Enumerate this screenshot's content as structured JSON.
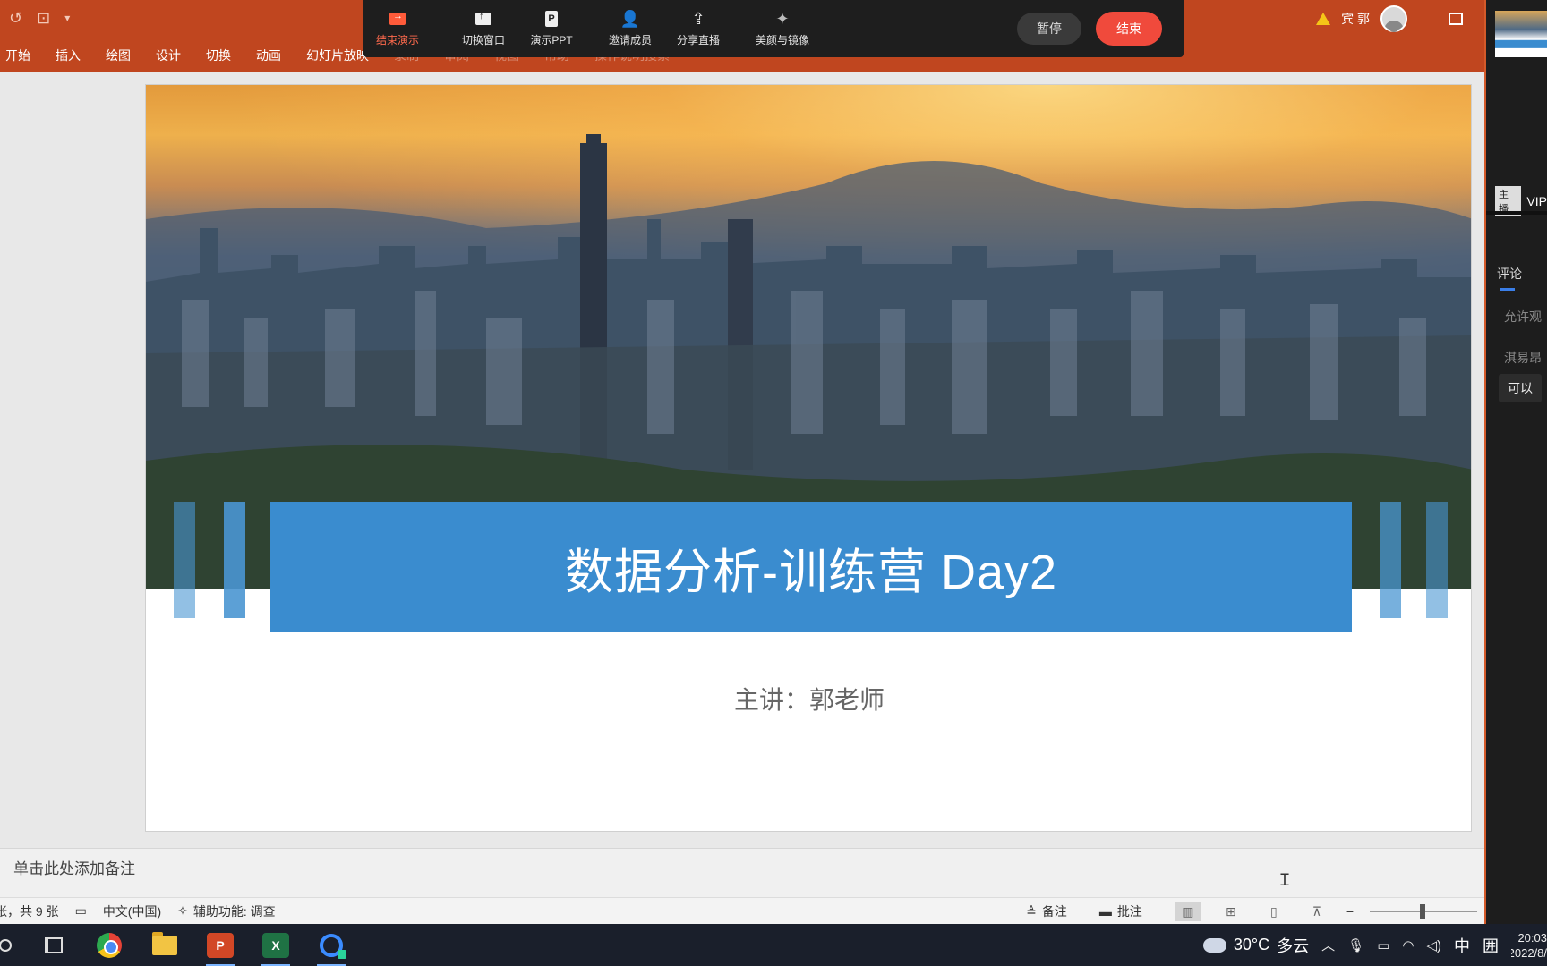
{
  "ppt": {
    "qat": [
      "↺",
      "⊡",
      "▾"
    ],
    "ribbon_tabs": [
      "开始",
      "插入",
      "绘图",
      "设计",
      "切换",
      "动画",
      "幻灯片放映",
      "录制",
      "审阅",
      "视图",
      "帮助",
      "操作说明搜索"
    ],
    "user_name": "宾 郭"
  },
  "meeting_toolbar": {
    "items": [
      {
        "label": "结束演示",
        "icon": "end-presentation-icon"
      },
      {
        "label": "切换窗口",
        "icon": "switch-window-icon"
      },
      {
        "label": "演示PPT",
        "icon": "ppt-icon"
      },
      {
        "label": "邀请成员",
        "icon": "invite-member-icon"
      },
      {
        "label": "分享直播",
        "icon": "share-live-icon"
      },
      {
        "label": "美颜与镜像",
        "icon": "beauty-mirror-icon"
      }
    ],
    "pause_label": "暂停",
    "end_label": "结束"
  },
  "slide": {
    "title": "数据分析-训练营 Day2",
    "subtitle": "主讲：郭老师",
    "band_color": "#3a8ccf"
  },
  "notes": {
    "placeholder": "单击此处添加备注"
  },
  "statusbar": {
    "slide_count": "张，共 9 张",
    "language": "中文(中国)",
    "accessibility": "辅助功能: 调查",
    "notes_label": "备注",
    "comments_label": "批注"
  },
  "side_panel": {
    "host_tag": "主播",
    "host_name": "VIP",
    "comment_tab": "评论",
    "line1": "允许观",
    "line2": "淇易昂",
    "message": "可以"
  },
  "taskbar": {
    "weather_temp": "30°C",
    "weather_text": "多云",
    "ime": "中",
    "ime2": "囲",
    "time": "20:03",
    "date": "2022/8/"
  },
  "colors": {
    "ppt_accent": "#c0461f",
    "end_button": "#f04a3c",
    "title_band": "#3a8ccf"
  }
}
